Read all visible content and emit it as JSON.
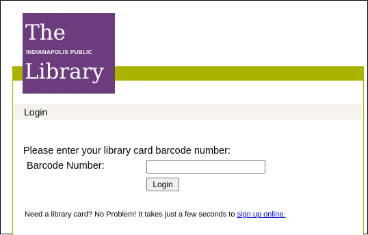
{
  "logo": {
    "line1": "The",
    "line2": "INDIANAPOLIS PUBLIC",
    "line3": "Library"
  },
  "section": {
    "title": "Login"
  },
  "form": {
    "prompt": "Please enter your library card barcode number:",
    "barcode_label": "Barcode Number:",
    "barcode_value": "",
    "barcode_placeholder": "",
    "submit_label": "Login"
  },
  "footer_note": {
    "text": "Need a library card? No Problem! It takes just a few seconds to ",
    "link_text": "sign up online."
  },
  "colors": {
    "brand_purple": "#6a3a7c",
    "accent_olive": "#a8b400",
    "header_band": "#f6f3ee",
    "link": "#0000ee"
  }
}
